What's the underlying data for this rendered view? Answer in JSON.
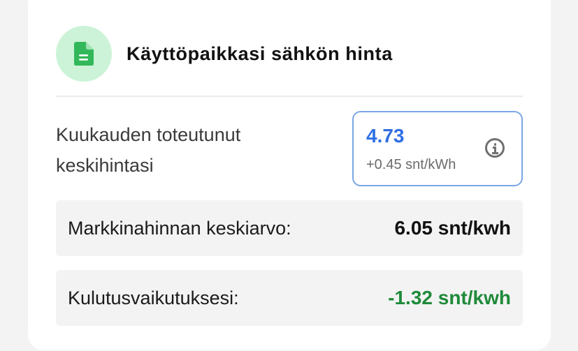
{
  "header": {
    "title": "Käyttöpaikkasi sähkön hinta",
    "icon": "document-icon"
  },
  "monthly": {
    "label": "Kuukauden toteutunut keskihintasi",
    "value": "4.73",
    "difference": "+0.45 snt/kWh",
    "info_icon": "info-icon"
  },
  "rows": [
    {
      "label": "Markkinahinnan keskiarvo:",
      "value": "6.05 snt/kwh"
    },
    {
      "label": "Kulutusvaikutuksesi:",
      "value": "-1.32 snt/kwh"
    }
  ],
  "colors": {
    "accent_blue": "#2f6fe4",
    "positive_green": "#1f8a3a",
    "icon_green": "#32b85a",
    "icon_bg": "#ccf3d7",
    "box_border": "#7aa6e6"
  }
}
